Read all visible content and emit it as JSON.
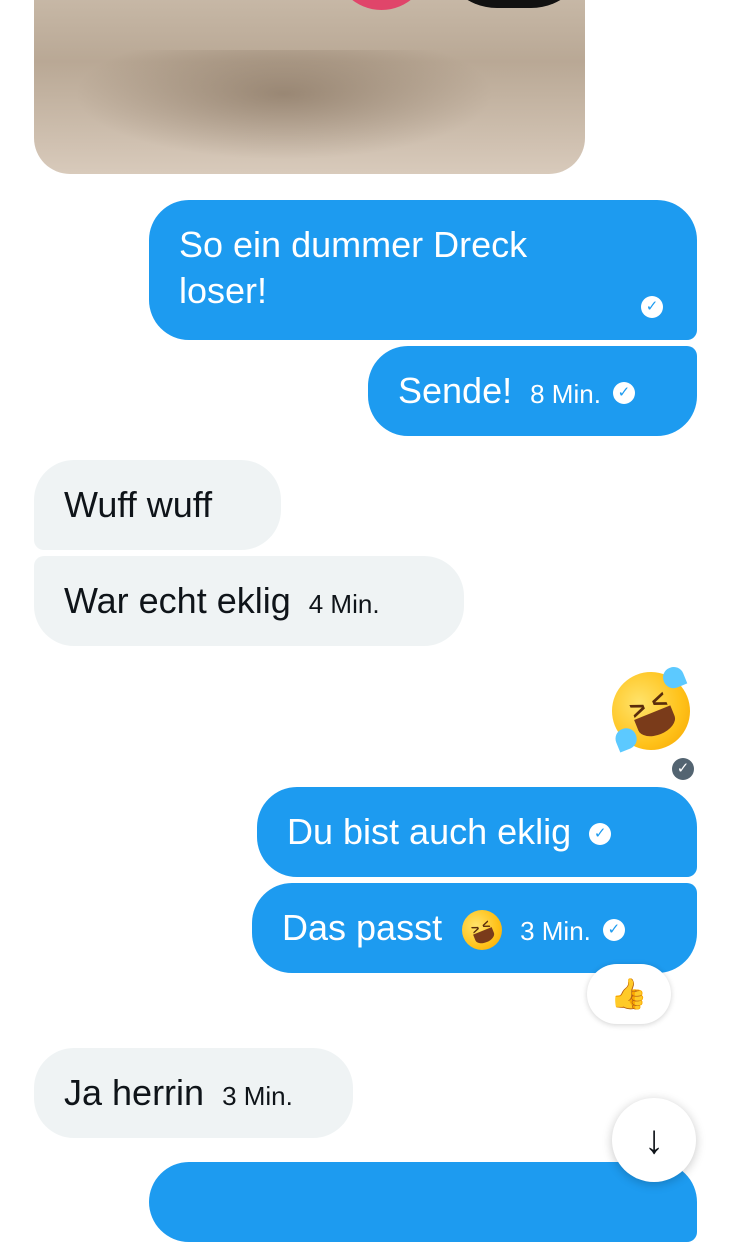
{
  "messages": [
    {
      "id": "m1",
      "direction": "sent",
      "text": "So ein dummer Dreck loser!"
    },
    {
      "id": "m2",
      "direction": "sent",
      "text": "Sende!",
      "time": "8 Min."
    },
    {
      "id": "m3",
      "direction": "received",
      "text": "Wuff wuff"
    },
    {
      "id": "m4",
      "direction": "received",
      "text": "War echt eklig",
      "time": "4 Min."
    },
    {
      "id": "m5",
      "direction": "sent",
      "text": "🤣",
      "emoji_only": true
    },
    {
      "id": "m6",
      "direction": "sent",
      "text": "Du bist auch eklig"
    },
    {
      "id": "m7",
      "direction": "sent",
      "text": "Das passt",
      "emoji": "🤣",
      "time": "3 Min.",
      "reaction": "👍"
    },
    {
      "id": "m8",
      "direction": "received",
      "text": "Ja herrin",
      "time": "3 Min."
    }
  ],
  "icons": {
    "read_receipt": "check-circle-icon",
    "scroll_down": "arrow-down-icon",
    "reaction": "thumbs-up-icon"
  },
  "colors": {
    "sent_bubble": "#1d9bf0",
    "received_bubble": "#eff3f4",
    "text_dark": "#0f1419"
  },
  "glyphs": {
    "check": "✓",
    "arrow_down": "↓",
    "thumbs_up": "👍"
  }
}
